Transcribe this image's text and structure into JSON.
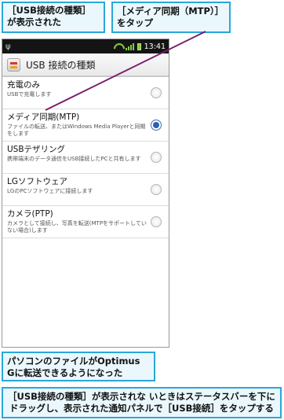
{
  "callouts": {
    "usb_type_shown": "［USB接続の種類］が表示された",
    "tap_media_sync": "［メディア同期（MTP）］をタップ",
    "transfer_ready": "パソコンのファイルがOptimus Gに転送できるようになった",
    "hint": "［USB接続の種類］が表示されな いときはステータスバーを下にドラッグし、表示された通知パネルで［USB接続］をタップする"
  },
  "statusbar": {
    "usb_icon": "usb-icon",
    "clock": "13:41"
  },
  "screen": {
    "title": "USB 接続の種類",
    "options": [
      {
        "label": "充電のみ",
        "desc": "USBで充電します",
        "selected": false
      },
      {
        "label": "メディア同期(MTP)",
        "desc": "ファイルの転送、またはWindows Media Playerと同期をします",
        "selected": true
      },
      {
        "label": "USBテザリング",
        "desc": "携帯端末のデータ通信をUSB接続したPCと共有します",
        "selected": false
      },
      {
        "label": "LGソフトウェア",
        "desc": "LGのPCソフトウェアに接続します",
        "selected": false
      },
      {
        "label": "カメラ(PTP)",
        "desc": "カメラとして接続し、写真を転送(MTPをサポートしていない場合)します",
        "selected": false
      }
    ]
  },
  "colors": {
    "callout_border": "#2aa7d8",
    "callout_fill": "#eaf7fd",
    "pointer_line": "#7a1f6e",
    "radio_selected": "#2f5fb3"
  }
}
